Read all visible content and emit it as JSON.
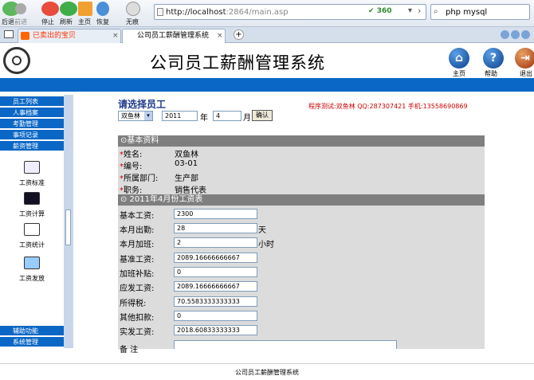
{
  "browser": {
    "nav_buttons": [
      {
        "label": "后退"
      },
      {
        "label": "前进"
      },
      {
        "label": "停止"
      },
      {
        "label": "刷新"
      },
      {
        "label": "主页"
      },
      {
        "label": "恢复"
      },
      {
        "label": "无痕"
      }
    ],
    "address_host": "http://localhost",
    "address_rest": ":2864/main.asp",
    "address_badge": "360",
    "search_text": "php mysql",
    "tabs": [
      {
        "label": "已卖出的宝贝"
      },
      {
        "label": "公司员工薪酬管理系统"
      }
    ]
  },
  "app": {
    "title": "公司员工薪酬管理系统",
    "header_actions": [
      {
        "label": "主页"
      },
      {
        "label": "帮助"
      },
      {
        "label": "退出"
      }
    ]
  },
  "nav": {
    "top_items": [
      "员工列表",
      "人事档案",
      "考勤管理",
      "事项记录",
      "薪资管理"
    ],
    "sub_items": [
      "工资标准",
      "工资计算",
      "工资统计",
      "工资发放"
    ],
    "bottom_items": [
      "辅助功能",
      "系统管理"
    ]
  },
  "main": {
    "heading": "请选择员工",
    "program_info": "程序测试:双鱼林 QQ:287307421 手机:13558690869",
    "employee_select": "双鱼林",
    "year_value": "2011",
    "year_unit": "年",
    "month_value": "4",
    "month_unit": "月",
    "confirm_label": "确认",
    "basic_section": "⊙基本资料",
    "basic_fields": [
      {
        "label": "姓名:",
        "value": "双鱼林"
      },
      {
        "label": "编号:",
        "value": "03-01"
      },
      {
        "label": "所属部门:",
        "value": "生产部"
      },
      {
        "label": "职务:",
        "value": "销售代表"
      }
    ],
    "wage_section": "⊙ 2011年4月份工资表",
    "wage_fields": [
      {
        "label": "基本工资:",
        "value": "2300",
        "unit": ""
      },
      {
        "label": "本月出勤:",
        "value": "28",
        "unit": "天"
      },
      {
        "label": "本月加班:",
        "value": "2",
        "unit": "小时"
      },
      {
        "label": "基准工资:",
        "value": "2089.16666666667",
        "unit": ""
      },
      {
        "label": "加班补贴:",
        "value": "0",
        "unit": ""
      },
      {
        "label": "应发工资:",
        "value": "2089.16666666667",
        "unit": ""
      },
      {
        "label": "所得税:",
        "value": "70.5583333333333",
        "unit": ""
      },
      {
        "label": "其他扣款:",
        "value": "0",
        "unit": ""
      },
      {
        "label": "实发工资:",
        "value": "2018.60833333333",
        "unit": ""
      }
    ],
    "remark_label": "备  注"
  },
  "footer": {
    "text": "公司员工薪酬管理系统"
  },
  "colors": {
    "nav_blue": "#0a67c6",
    "section_gray": "#7f7f7f",
    "info_red": "#cc0000"
  }
}
